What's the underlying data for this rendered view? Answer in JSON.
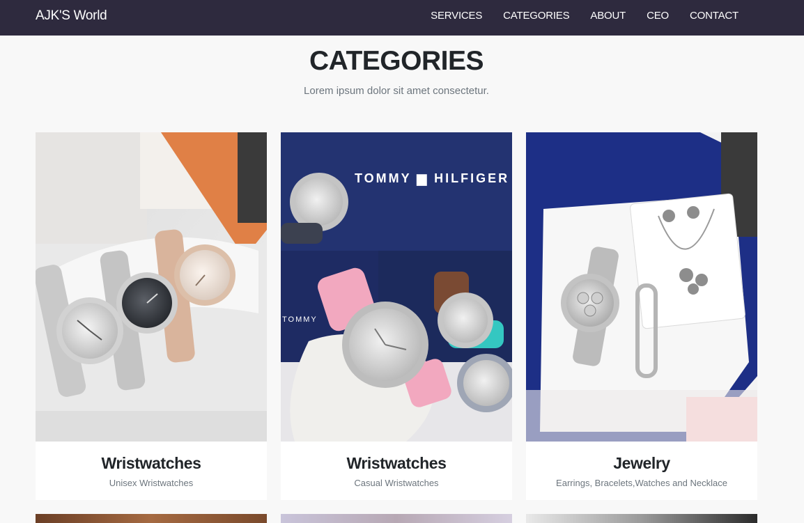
{
  "navbar": {
    "brand": "AJK'S World",
    "links": [
      "SERVICES",
      "CATEGORIES",
      "ABOUT",
      "CEO",
      "CONTACT"
    ]
  },
  "section": {
    "heading": "CATEGORIES",
    "subheading": "Lorem ipsum dolor sit amet consectetur."
  },
  "cards": [
    {
      "title": "Wristwatches",
      "caption": "Unisex Wristwatches"
    },
    {
      "title": "Wristwatches",
      "caption": "Casual Wristwatches"
    },
    {
      "title": "Jewelry",
      "caption": "Earrings, Bracelets,Watches and Necklace"
    }
  ],
  "photo_text": {
    "brand_banner": "TOMMY ▆ HILFIGER",
    "brand_side": "TOMMY"
  },
  "colors": {
    "navbar_bg": "#2e2a3e",
    "page_bg": "#f8f8f8",
    "muted_text": "#6c757d"
  }
}
